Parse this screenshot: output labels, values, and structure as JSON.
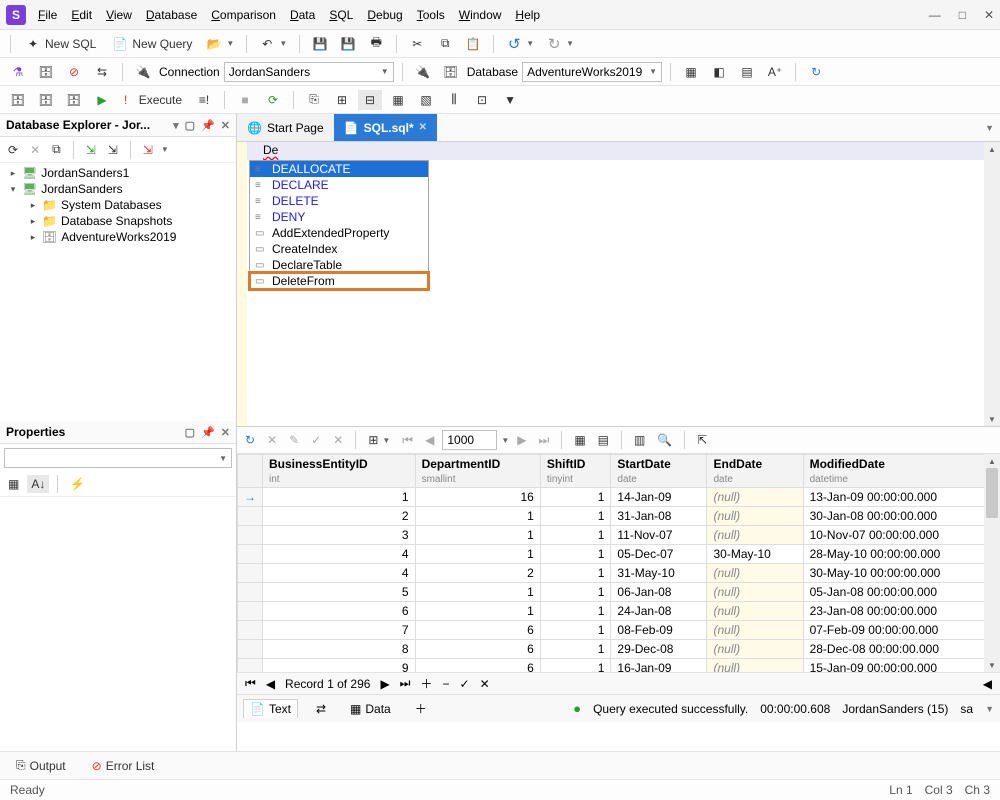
{
  "app_icon": "S",
  "menu": [
    "File",
    "Edit",
    "View",
    "Database",
    "Comparison",
    "Data",
    "SQL",
    "Debug",
    "Tools",
    "Window",
    "Help"
  ],
  "toolbar1": {
    "new_sql": "New SQL",
    "new_query": "New Query"
  },
  "toolbar2": {
    "connection_label": "Connection",
    "connection_value": "JordanSanders",
    "database_label": "Database",
    "database_value": "AdventureWorks2019"
  },
  "toolbar3": {
    "execute": "Execute"
  },
  "db_explorer": {
    "title": "Database Explorer - Jor...",
    "roots": [
      {
        "label": "JordanSanders1"
      },
      {
        "label": "JordanSanders"
      }
    ],
    "children": [
      {
        "label": "System Databases",
        "kind": "folder"
      },
      {
        "label": "Database Snapshots",
        "kind": "folder"
      },
      {
        "label": "AdventureWorks2019",
        "kind": "db"
      }
    ]
  },
  "properties": {
    "title": "Properties"
  },
  "tabs": {
    "start": "Start Page",
    "sql": "SQL.sql*"
  },
  "editor_text": "De",
  "autocomplete": [
    {
      "label": "DEALLOCATE",
      "kind": "kw",
      "sel": true
    },
    {
      "label": "DECLARE",
      "kind": "kw"
    },
    {
      "label": "DELETE",
      "kind": "kw"
    },
    {
      "label": "DENY",
      "kind": "kw"
    },
    {
      "label": "AddExtendedProperty",
      "kind": "snip"
    },
    {
      "label": "CreateIndex",
      "kind": "snip"
    },
    {
      "label": "DeclareTable",
      "kind": "snip"
    },
    {
      "label": "DeleteFrom",
      "kind": "snip",
      "hilite": true
    }
  ],
  "pager_value": "1000",
  "grid": {
    "columns": [
      {
        "name": "BusinessEntityID",
        "type": "int"
      },
      {
        "name": "DepartmentID",
        "type": "smallint"
      },
      {
        "name": "ShiftID",
        "type": "tinyint"
      },
      {
        "name": "StartDate",
        "type": "date"
      },
      {
        "name": "EndDate",
        "type": "date"
      },
      {
        "name": "ModifiedDate",
        "type": "datetime"
      }
    ],
    "rows": [
      [
        1,
        16,
        1,
        "14-Jan-09",
        "(null)",
        "13-Jan-09 00:00:00.000"
      ],
      [
        2,
        1,
        1,
        "31-Jan-08",
        "(null)",
        "30-Jan-08 00:00:00.000"
      ],
      [
        3,
        1,
        1,
        "11-Nov-07",
        "(null)",
        "10-Nov-07 00:00:00.000"
      ],
      [
        4,
        1,
        1,
        "05-Dec-07",
        "30-May-10",
        "28-May-10 00:00:00.000"
      ],
      [
        4,
        2,
        1,
        "31-May-10",
        "(null)",
        "30-May-10 00:00:00.000"
      ],
      [
        5,
        1,
        1,
        "06-Jan-08",
        "(null)",
        "05-Jan-08 00:00:00.000"
      ],
      [
        6,
        1,
        1,
        "24-Jan-08",
        "(null)",
        "23-Jan-08 00:00:00.000"
      ],
      [
        7,
        6,
        1,
        "08-Feb-09",
        "(null)",
        "07-Feb-09 00:00:00.000"
      ],
      [
        8,
        6,
        1,
        "29-Dec-08",
        "(null)",
        "28-Dec-08 00:00:00.000"
      ],
      [
        9,
        6,
        1,
        "16-Jan-09",
        "(null)",
        "15-Jan-09 00:00:00.000"
      ]
    ]
  },
  "record_label": "Record 1 of 296",
  "result_tabs": {
    "text": "Text",
    "data": "Data"
  },
  "query_status": "Query executed successfully.",
  "query_time": "00:00:00.608",
  "conn_status": "JordanSanders (15)",
  "user_status": "sa",
  "bottom": {
    "output": "Output",
    "error_list": "Error List"
  },
  "statusbar": {
    "ready": "Ready",
    "ln": "Ln 1",
    "col": "Col 3",
    "ch": "Ch 3"
  }
}
